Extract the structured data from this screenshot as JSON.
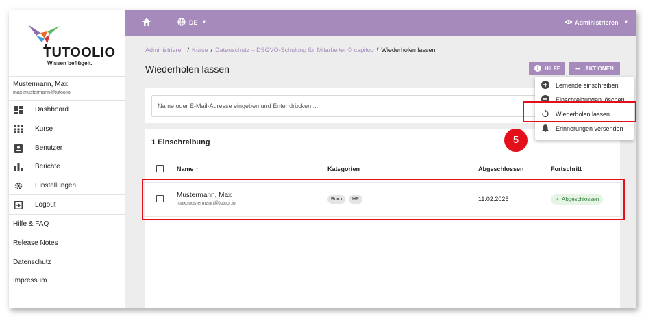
{
  "brand": {
    "name": "TUTOOLIO",
    "tagline": "Wissen beflügelt."
  },
  "user": {
    "name": "Mustermann, Max",
    "email": "max.mustermann@tutoolio"
  },
  "sidebar": {
    "items": [
      {
        "label": "Dashboard",
        "icon": "dashboard-icon"
      },
      {
        "label": "Kurse",
        "icon": "grid-icon"
      },
      {
        "label": "Benutzer",
        "icon": "user-card-icon"
      },
      {
        "label": "Berichte",
        "icon": "bar-chart-icon"
      },
      {
        "label": "Einstellungen",
        "icon": "gear-icon"
      },
      {
        "label": "Logout",
        "icon": "logout-icon"
      }
    ],
    "links": [
      "Hilfe & FAQ",
      "Release Notes",
      "Datenschutz",
      "Impressum"
    ]
  },
  "topbar": {
    "language": "DE",
    "admin_label": "Administrieren",
    "bg_color": "#a58abb"
  },
  "breadcrumb": {
    "items": [
      "Administrieren",
      "Kurse",
      "Datenschutz – DSGVO-Schulung für Mitarbeiter © capitoo"
    ],
    "separator": "/",
    "current": "Wiederholen lassen"
  },
  "page": {
    "title": "Wiederholen lassen",
    "help_label": "HILFE",
    "actions_label": "AKTIONEN",
    "search_placeholder": "Name oder E-Mail-Adresse eingeben und Enter drücken ..."
  },
  "menu": {
    "items": [
      {
        "label": "Lernende einschreiben",
        "icon": "plus-circle-icon"
      },
      {
        "label": "Einschreibungen löschen",
        "icon": "minus-circle-icon"
      },
      {
        "label": "Wiederholen lassen",
        "icon": "restart-icon"
      },
      {
        "label": "Erinnerungen versenden",
        "icon": "bell-icon"
      }
    ]
  },
  "table": {
    "count_title": "1 Einschreibung",
    "columns": [
      "Name",
      "Kategorien",
      "Abgeschlossen",
      "Fortschritt"
    ],
    "rows": [
      {
        "name": "Mustermann, Max",
        "email": "max.mustermann@tutool.io",
        "categories": [
          "Bonn",
          "HR"
        ],
        "completed": "11.02.2025",
        "status": "Abgeschlossen"
      }
    ]
  },
  "annotation": {
    "step": "5",
    "color": "#e3101c"
  }
}
